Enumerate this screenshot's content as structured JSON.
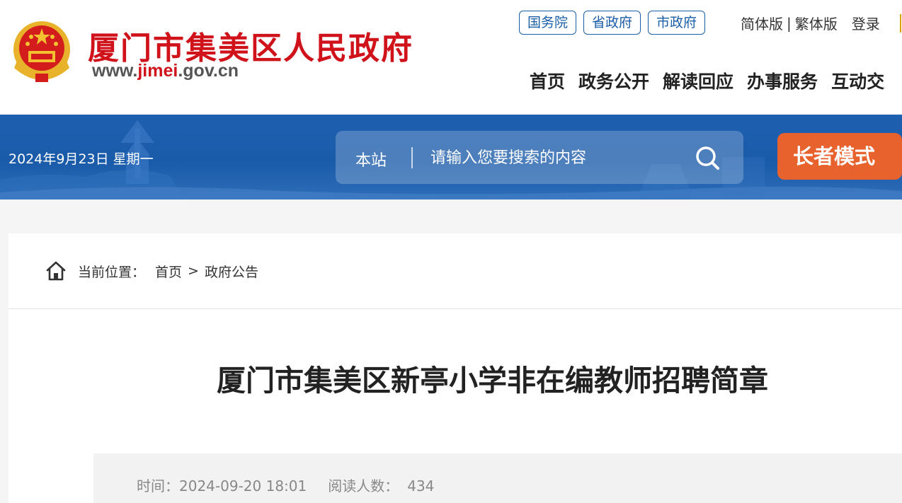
{
  "header": {
    "site_title": "厦门市集美区人民政府",
    "url_prefix": "www.",
    "url_highlight": "jimei",
    "url_suffix": ".gov.cn",
    "gov_links": [
      "国务院",
      "省政府",
      "市政府"
    ],
    "lang_simplified": "简体版",
    "lang_separator": "|",
    "lang_traditional": "繁体版",
    "login": "登录",
    "nav": [
      "首页",
      "政务公开",
      "解读回应",
      "办事服务",
      "互动交"
    ]
  },
  "banner": {
    "date": "2024年9月23日 星期一",
    "search_scope": "本站",
    "search_placeholder": "请输入您要搜索的内容",
    "search_icon": "search-icon",
    "elder_mode": "长者模式"
  },
  "breadcrumb": {
    "label": "当前位置：",
    "home": "首页",
    "separator": ">",
    "current": "政府公告"
  },
  "article": {
    "title": "厦门市集美区新亭小学非在编教师招聘简章",
    "time_label": "时间：",
    "time_value": "2024-09-20 18:01",
    "views_label": "阅读人数：",
    "views_value": "434"
  },
  "colors": {
    "brand_red": "#d0121b",
    "banner_blue": "#1f5fb0",
    "link_blue": "#1a5ea8",
    "elder_orange": "#e8622d"
  }
}
